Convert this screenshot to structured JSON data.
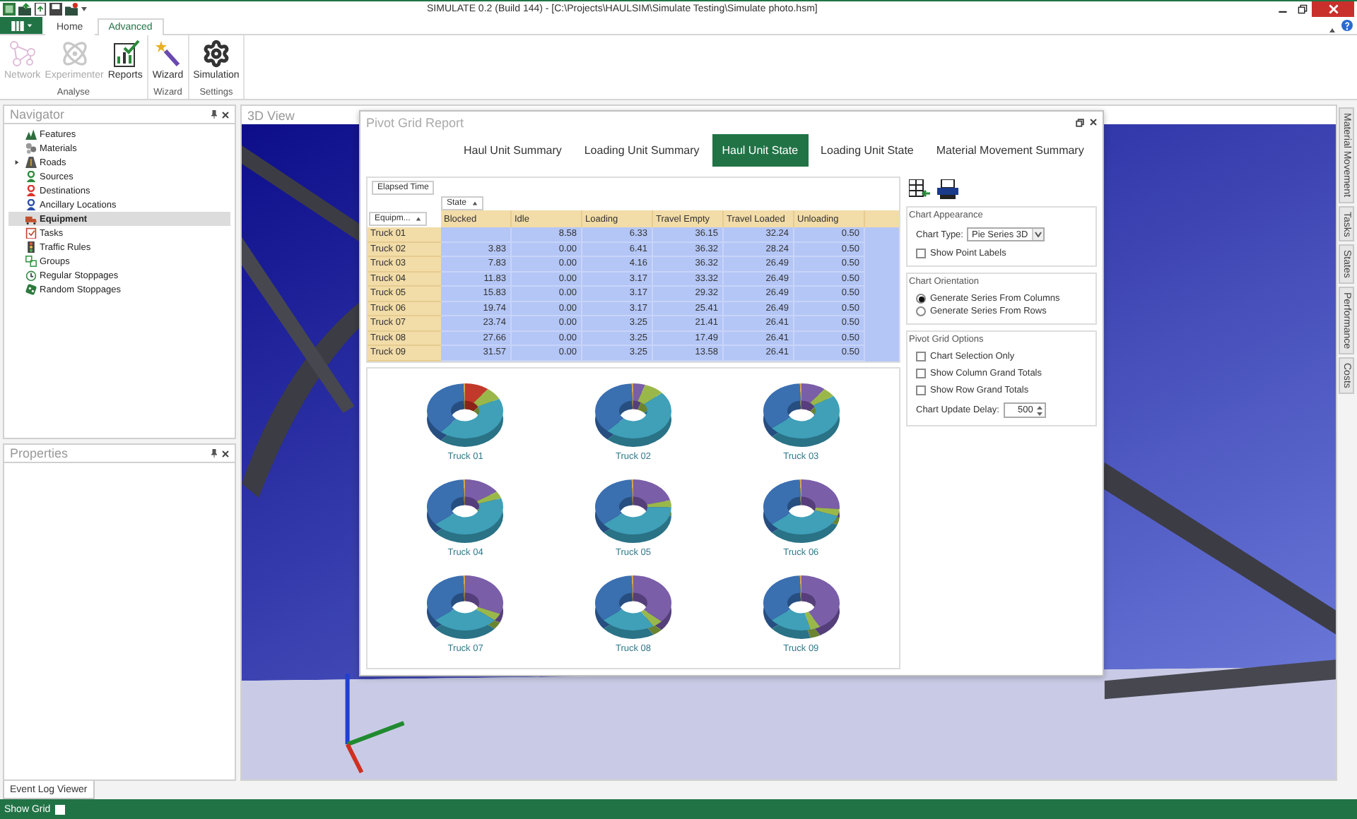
{
  "window": {
    "title": "SIMULATE 0.2 (Build 144) - [C:\\Projects\\HAULSIM\\Simulate Testing\\Simulate photo.hsm]"
  },
  "ribbon": {
    "tabs": [
      {
        "label": "Home",
        "selected": false
      },
      {
        "label": "Advanced",
        "selected": true
      }
    ],
    "groups": [
      {
        "label": "Analyse",
        "buttons": [
          {
            "label": "Network",
            "kind": "network",
            "disabled": true
          },
          {
            "label": "Experimenter",
            "kind": "atom",
            "disabled": true
          },
          {
            "label": "Reports",
            "kind": "report",
            "disabled": false
          }
        ]
      },
      {
        "label": "Wizard",
        "buttons": [
          {
            "label": "Wizard",
            "kind": "wand",
            "disabled": false
          }
        ]
      },
      {
        "label": "Settings",
        "buttons": [
          {
            "label": "Simulation",
            "kind": "gear",
            "disabled": false
          }
        ]
      }
    ]
  },
  "navigator": {
    "title": "Navigator",
    "items": [
      {
        "label": "Features",
        "kind": "mountain",
        "selected": false,
        "expandable": false
      },
      {
        "label": "Materials",
        "kind": "dots",
        "selected": false,
        "expandable": false
      },
      {
        "label": "Roads",
        "kind": "road",
        "selected": false,
        "expandable": true
      },
      {
        "label": "Sources",
        "kind": "person",
        "color": "#2e8b3e",
        "selected": false,
        "expandable": false
      },
      {
        "label": "Destinations",
        "kind": "person",
        "color": "#d9342b",
        "selected": false,
        "expandable": false
      },
      {
        "label": "Ancillary Locations",
        "kind": "person",
        "color": "#2b4fa8",
        "selected": false,
        "expandable": false
      },
      {
        "label": "Equipment",
        "kind": "truck",
        "selected": true,
        "expandable": false
      },
      {
        "label": "Tasks",
        "kind": "clipboard",
        "selected": false,
        "expandable": false
      },
      {
        "label": "Traffic Rules",
        "kind": "traffic",
        "selected": false,
        "expandable": false
      },
      {
        "label": "Groups",
        "kind": "squares",
        "selected": false,
        "expandable": false
      },
      {
        "label": "Regular Stoppages",
        "kind": "clock",
        "selected": false,
        "expandable": false
      },
      {
        "label": "Random Stoppages",
        "kind": "dice",
        "selected": false,
        "expandable": false
      }
    ]
  },
  "properties": {
    "title": "Properties"
  },
  "view": {
    "title": "3D View"
  },
  "pivot": {
    "title": "Pivot Grid Report",
    "tabs": [
      {
        "label": "Haul Unit Summary",
        "selected": false
      },
      {
        "label": "Loading Unit Summary",
        "selected": false
      },
      {
        "label": "Haul Unit State",
        "selected": true
      },
      {
        "label": "Loading Unit State",
        "selected": false
      },
      {
        "label": "Material Movement Summary",
        "selected": false
      }
    ],
    "table": {
      "data_field": "Elapsed Time",
      "column_field": "State",
      "row_field": "Equipm...",
      "columns": [
        "Blocked",
        "Idle",
        "Loading",
        "Travel Empty",
        "Travel Loaded",
        "Unloading"
      ],
      "rows": [
        {
          "label": "Truck 01",
          "idle": "8.58",
          "loading": "6.33",
          "travel_empty": "36.15",
          "travel_loaded": "32.24",
          "unloading": "0.50"
        },
        {
          "label": "Truck 02",
          "blocked": "3.83",
          "idle": "0.00",
          "loading": "6.41",
          "travel_empty": "36.32",
          "travel_loaded": "28.24",
          "unloading": "0.50"
        },
        {
          "label": "Truck 03",
          "blocked": "7.83",
          "idle": "0.00",
          "loading": "4.16",
          "travel_empty": "36.32",
          "travel_loaded": "26.49",
          "unloading": "0.50"
        },
        {
          "label": "Truck 04",
          "blocked": "11.83",
          "idle": "0.00",
          "loading": "3.17",
          "travel_empty": "33.32",
          "travel_loaded": "26.49",
          "unloading": "0.50"
        },
        {
          "label": "Truck 05",
          "blocked": "15.83",
          "idle": "0.00",
          "loading": "3.17",
          "travel_empty": "29.32",
          "travel_loaded": "26.49",
          "unloading": "0.50"
        },
        {
          "label": "Truck 06",
          "blocked": "19.74",
          "idle": "0.00",
          "loading": "3.17",
          "travel_empty": "25.41",
          "travel_loaded": "26.49",
          "unloading": "0.50"
        },
        {
          "label": "Truck 07",
          "blocked": "23.74",
          "idle": "0.00",
          "loading": "3.25",
          "travel_empty": "21.41",
          "travel_loaded": "26.41",
          "unloading": "0.50"
        },
        {
          "label": "Truck 08",
          "blocked": "27.66",
          "idle": "0.00",
          "loading": "3.25",
          "travel_empty": "17.49",
          "travel_loaded": "26.41",
          "unloading": "0.50"
        },
        {
          "label": "Truck 09",
          "blocked": "31.57",
          "idle": "0.00",
          "loading": "3.25",
          "travel_empty": "13.58",
          "travel_loaded": "26.41",
          "unloading": "0.50"
        }
      ]
    },
    "charts": [
      {
        "label": "Truck 01"
      },
      {
        "label": "Truck 02"
      },
      {
        "label": "Truck 03"
      },
      {
        "label": "Truck 04"
      },
      {
        "label": "Truck 05"
      },
      {
        "label": "Truck 06"
      },
      {
        "label": "Truck 07"
      },
      {
        "label": "Truck 08"
      },
      {
        "label": "Truck 09"
      }
    ],
    "options": {
      "appearance": {
        "title": "Chart Appearance",
        "chart_type_label": "Chart Type:",
        "chart_type": "Pie Series 3D",
        "point_labels": {
          "label": "Show Point Labels",
          "checked": false
        }
      },
      "orientation": {
        "title": "Chart Orientation",
        "choices": [
          {
            "label": "Generate Series From Columns",
            "selected": true
          },
          {
            "label": "Generate Series From Rows",
            "selected": false
          }
        ]
      },
      "grid_options": {
        "title": "Pivot Grid Options",
        "checks": [
          {
            "label": "Chart Selection Only",
            "checked": false
          },
          {
            "label": "Show Column Grand Totals",
            "checked": false
          },
          {
            "label": "Show Row Grand Totals",
            "checked": false
          }
        ],
        "delay_label": "Chart Update Delay:",
        "delay": "500"
      }
    }
  },
  "side_tabs": [
    "Material Movement",
    "Tasks",
    "States",
    "Performance",
    "Costs"
  ],
  "bottom_tabs": [
    {
      "label": "Event Log Viewer"
    }
  ],
  "status_bar": {
    "show_grid": {
      "label": "Show Grid",
      "checked": false
    }
  }
}
